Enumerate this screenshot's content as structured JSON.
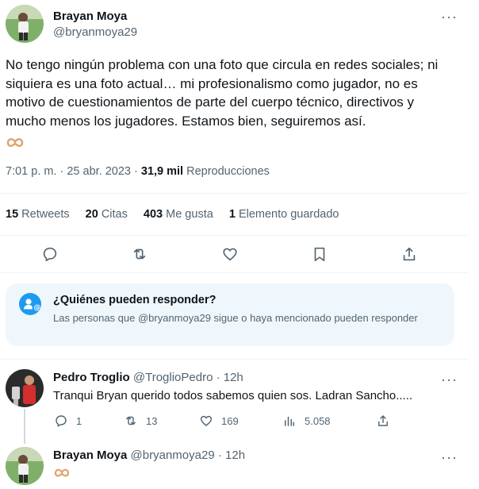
{
  "tweet": {
    "author_name": "Brayan Moya",
    "author_handle": "@bryanmoya29",
    "text": "No tengo ningún problema con una foto que circula en redes sociales; ni siquiera es una foto actual… mi profesionalismo como jugador, no es motivo de cuestionamientos de parte del cuerpo técnico, directivos y mucho menos los jugadores. Estamos bien, seguiremos así.",
    "emoji": "🫶",
    "time": "7:01 p. m. · 25 abr. 2023 ·",
    "views_count": "31,9 mil",
    "views_label": "Reproducciones",
    "more": "···"
  },
  "stats": {
    "retweets_count": "15",
    "retweets_label": "Retweets",
    "quotes_count": "20",
    "quotes_label": "Citas",
    "likes_count": "403",
    "likes_label": "Me gusta",
    "bookmarks_count": "1",
    "bookmarks_label": "Elemento guardado"
  },
  "who_can_reply": {
    "title": "¿Quiénes pueden responder?",
    "body": "Las personas que @bryanmoya29 sigue o haya mencionado pueden responder"
  },
  "replies": [
    {
      "author_name": "Pedro Troglio",
      "author_handle": "@TroglioPedro",
      "time": "· 12h",
      "text": "Tranqui Bryan querido todos sabemos quien sos. Ladran Sancho.....",
      "reply_count": "1",
      "retweet_count": "13",
      "like_count": "169",
      "views_count": "5.058",
      "more": "···"
    },
    {
      "author_name": "Brayan Moya",
      "author_handle": "@bryanmoya29",
      "time": "· 12h",
      "emoji": "🫶",
      "more": "···"
    }
  ],
  "colors": {
    "accent": "#1d9bf0",
    "text": "#0f1419",
    "muted": "#536471",
    "divider": "#eff3f4",
    "info_bg": "#f0f7fc"
  }
}
